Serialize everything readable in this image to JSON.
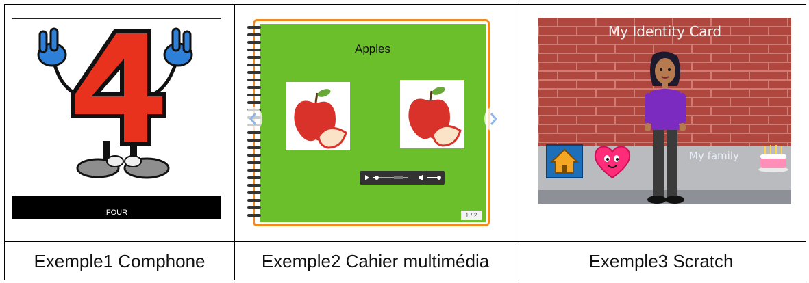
{
  "table": {
    "captions": [
      "Exemple1 Comphone",
      "Exemple2 Cahier multimédia",
      "Exemple3 Scratch"
    ]
  },
  "comphone": {
    "number": "4",
    "label": "FOUR",
    "colors": {
      "number_fill": "#e8321e",
      "gloves": "#2d7fd8",
      "bar": "#000000"
    }
  },
  "cahier": {
    "title": "Apples",
    "page_indicator": "1 / 2",
    "colors": {
      "page": "#6bbf2a",
      "frame": "#f08a1e"
    },
    "audio_player": {
      "progress": 0.1
    }
  },
  "scratch": {
    "title": "My Identity Card",
    "family_label": "My family",
    "icons": [
      "home-icon",
      "heart-icon",
      "birthday-cake-icon"
    ],
    "colors": {
      "wall": "#b0473f",
      "shirt": "#7b2bbf",
      "home_button": "#1c6fb8",
      "heart": "#ff2c7a"
    }
  }
}
